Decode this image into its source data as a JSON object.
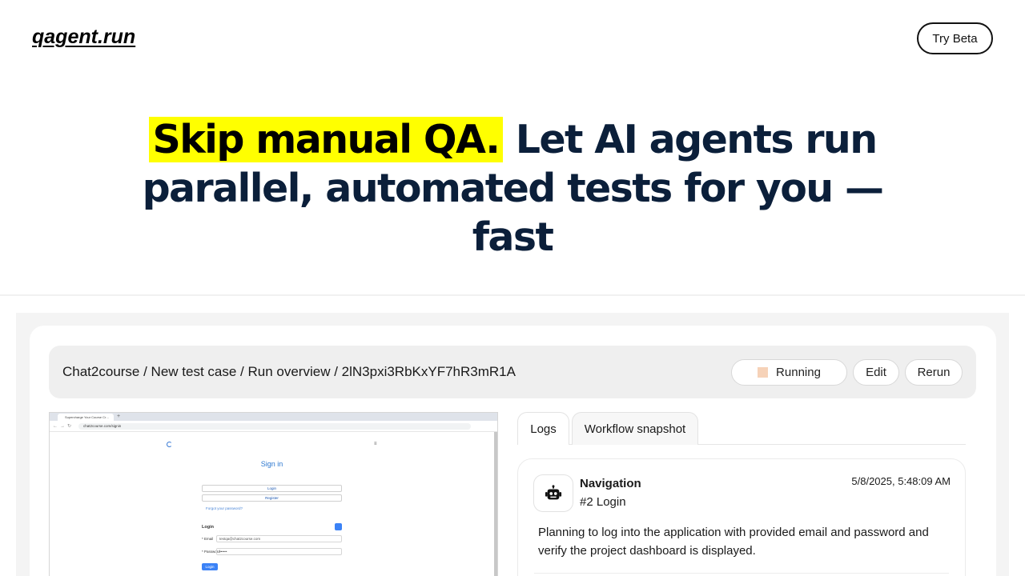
{
  "header": {
    "logo": "qagent.run",
    "cta_label": "Try Beta"
  },
  "hero": {
    "highlight": "Skip manual QA.",
    "line1_rest": "Let AI agents run",
    "line2": "parallel, automated tests for you —",
    "line3": "fast",
    "highlight_color": "#ffff00",
    "text_color": "#0b1f3a"
  },
  "run_bar": {
    "breadcrumb": "Chat2course / New test case / Run overview / 2lN3pxi3RbKxYF7hR3mR1A",
    "status_label": "Running",
    "status_color": "#f6d2b8",
    "edit_label": "Edit",
    "rerun_label": "Rerun"
  },
  "browser_preview": {
    "tab_title": "Supercharge Your Course Cr…",
    "url": "chat2course.com/signin",
    "heading": "Sign in",
    "login_tab": "Login",
    "register_tab": "Register",
    "forgot_link": "Forgot your password?",
    "form_title": "Login",
    "email_label": "* Email",
    "email_value": "testqa@chat2course.com",
    "password_label": "* Password",
    "password_placeholder": "••••••",
    "submit_label": "Login"
  },
  "tabs": {
    "logs": "Logs",
    "workflow": "Workflow snapshot"
  },
  "log_entry": {
    "icon": "robot-icon",
    "type": "Navigation",
    "step": "#2 Login",
    "timestamp": "5/8/2025, 5:48:09 AM",
    "message": "Planning to log into the application with provided email and password and verify the project dashboard is displayed."
  }
}
